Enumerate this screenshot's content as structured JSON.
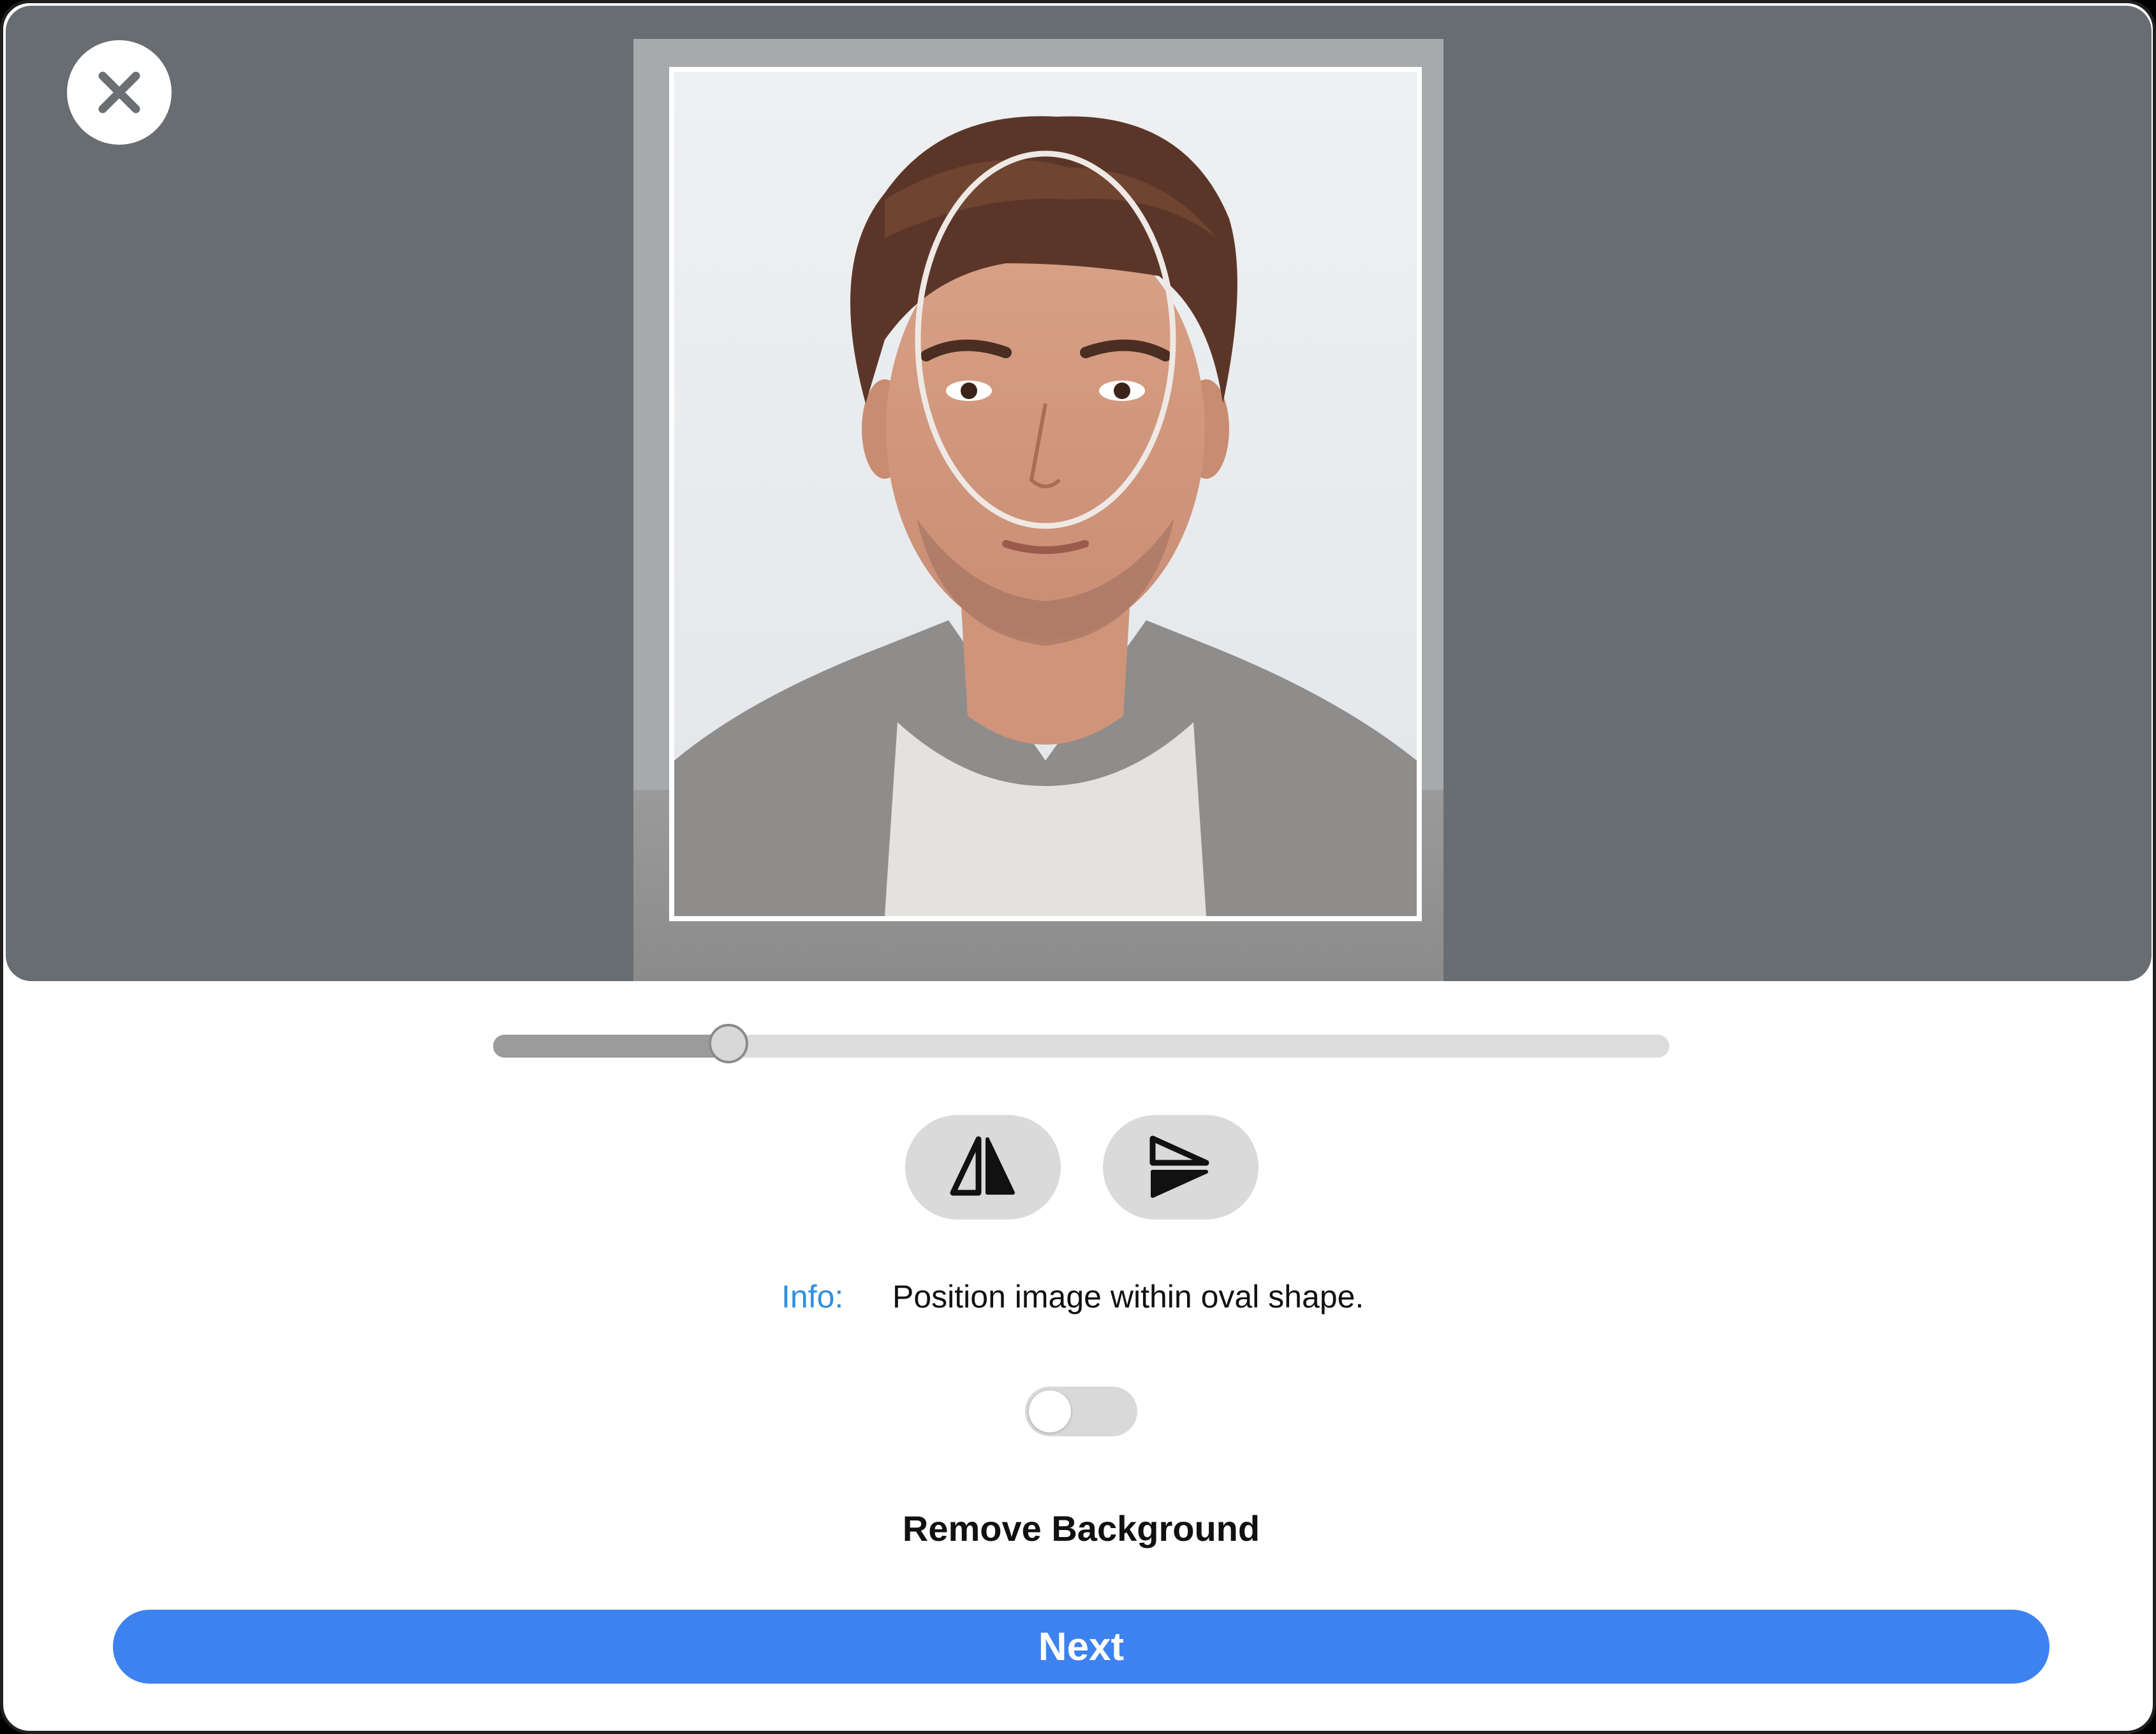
{
  "editor": {
    "close_icon": "close-icon",
    "photo_alt": "Portrait photo of a man",
    "oval_guide": "face-oval-guide"
  },
  "zoom_slider": {
    "value": 0.2
  },
  "tools": {
    "flip_horizontal_icon": "flip-horizontal-icon",
    "flip_vertical_icon": "flip-vertical-icon"
  },
  "info": {
    "label": "Info:",
    "text": "Position image within oval shape."
  },
  "remove_background": {
    "enabled": false,
    "label": "Remove Background"
  },
  "next_button": {
    "label": "Next",
    "color": "#3d82ee"
  },
  "colors": {
    "editor_bg": "#686d72",
    "info_accent": "#2f8fe0"
  }
}
